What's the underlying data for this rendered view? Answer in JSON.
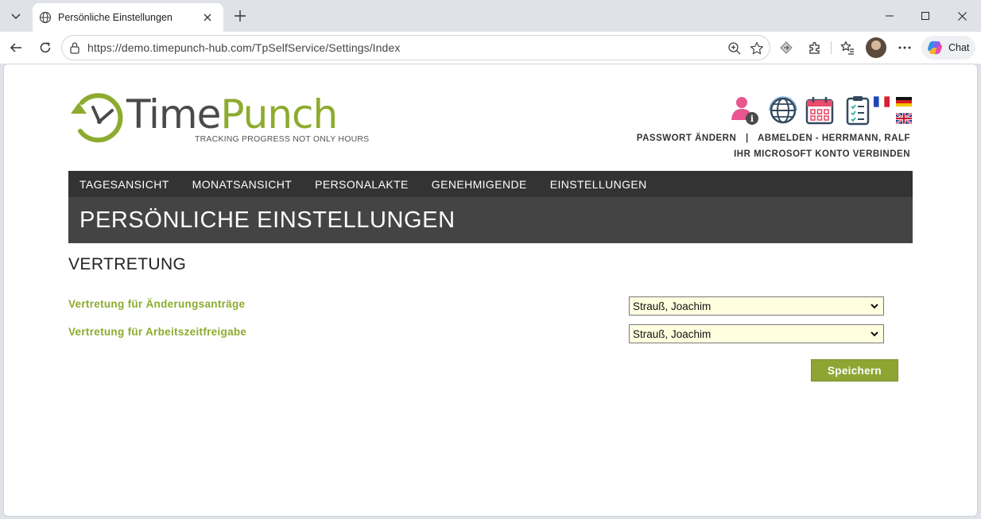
{
  "browser": {
    "tab_title": "Persönliche Einstellungen",
    "url": "https://demo.timepunch-hub.com/TpSelfService/Settings/Index",
    "chat_label": "Chat"
  },
  "header": {
    "logo_time": "Time",
    "logo_punch": "Punch",
    "tagline": "TRACKING PROGRESS NOT ONLY HOURS",
    "change_password": "PASSWORT ÄNDERN",
    "separator": "|",
    "logout": "ABMELDEN - HERRMANN, RALF",
    "connect_microsoft": "IHR MICROSOFT KONTO VERBINDEN",
    "icons": [
      "user-info-icon",
      "globe-icon",
      "calendar-icon",
      "clipboard-icon"
    ],
    "flags": [
      "flag-fr-icon",
      "flag-de-icon",
      "flag-uk-icon"
    ]
  },
  "nav": {
    "items": [
      "TAGESANSICHT",
      "MONATSANSICHT",
      "PERSONALAKTE",
      "GENEHMIGENDE",
      "EINSTELLUNGEN"
    ]
  },
  "page": {
    "title": "PERSÖNLICHE EINSTELLUNGEN",
    "section": "VERTRETUNG",
    "fields": [
      {
        "label": "Vertretung für Änderungsanträge",
        "value": "Strauß, Joachim"
      },
      {
        "label": "Vertretung für Arbeitszeitfreigabe",
        "value": "Strauß, Joachim"
      }
    ],
    "save_label": "Speichern"
  },
  "colors": {
    "accent_green": "#8dab2e",
    "nav_bg": "#333333",
    "title_bg": "#444444",
    "select_bg": "#ffffe0"
  }
}
